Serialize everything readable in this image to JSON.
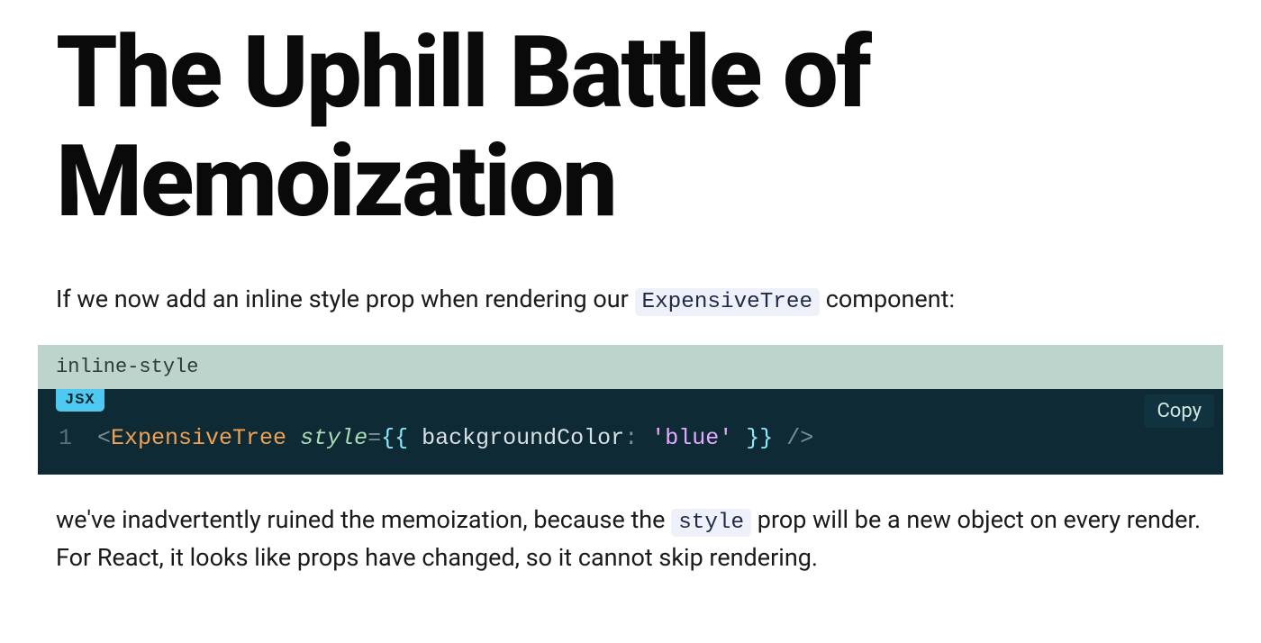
{
  "title": "The Uphill Battle of Memoization",
  "para1": {
    "before": "If we now add an inline style prop when rendering our ",
    "code": "ExpensiveTree",
    "after": " component:"
  },
  "code_block": {
    "title": "inline-style",
    "lang_badge": "JSX",
    "copy_label": "Copy",
    "line_number": "1",
    "tokens": {
      "open_angle": "<",
      "tag_name": "ExpensiveTree",
      "space1": " ",
      "attr_name": "style",
      "equals": "=",
      "brace_open": "{{",
      "space2": " ",
      "prop_name": "backgroundColor",
      "colon": ":",
      "space3": " ",
      "string_val": "'blue'",
      "space4": " ",
      "brace_close": "}}",
      "space5": " ",
      "self_close": "/>"
    }
  },
  "para2": {
    "before": "we've inadvertently ruined the memoization, because the ",
    "code": "style",
    "after": " prop will be a new object on every render. For React, it looks like props have changed, so it cannot skip rendering."
  }
}
